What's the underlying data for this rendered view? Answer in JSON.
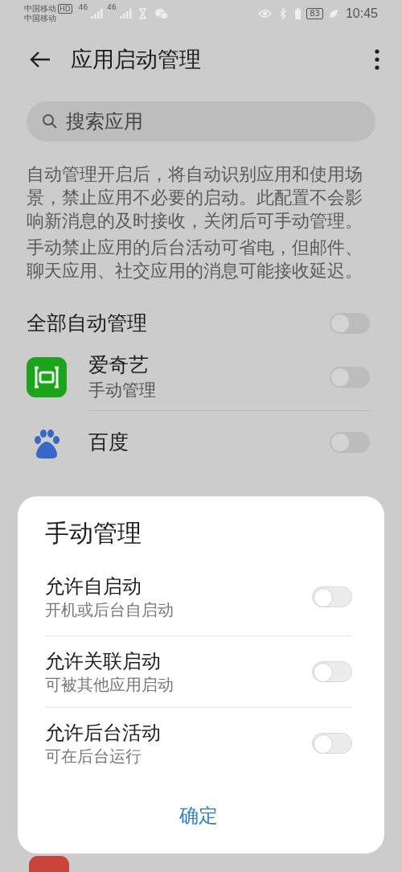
{
  "status_bar": {
    "carriers": [
      "中国移动",
      "中国移动"
    ],
    "hd_badge": "HD",
    "network_labels": [
      "46",
      "46"
    ],
    "battery": "83",
    "time": "10:45"
  },
  "header": {
    "title": "应用启动管理"
  },
  "search": {
    "placeholder": "搜索应用"
  },
  "description": [
    "自动管理开启后，将自动识别应用和使用场景，禁止应用不必要的启动。此配置不会影响新消息的及时接收，关闭后可手动管理。",
    "手动禁止应用的后台活动可省电，但邮件、聊天应用、社交应用的消息可能接收延迟。"
  ],
  "auto_all": {
    "label": "全部自动管理",
    "on": false
  },
  "apps": [
    {
      "kind": "tv",
      "name": "爱奇艺",
      "subtitle": "手动管理",
      "on": false
    },
    {
      "kind": "paw",
      "name": "百度",
      "on": false
    }
  ],
  "dialog": {
    "title": "手动管理",
    "options": [
      {
        "label": "允许自启动",
        "subtitle": "开机或后台自启动",
        "on": false
      },
      {
        "label": "允许关联启动",
        "subtitle": "可被其他应用启动",
        "on": false
      },
      {
        "label": "允许后台活动",
        "subtitle": "可在后台运行",
        "on": false
      }
    ],
    "confirm": "确定"
  }
}
